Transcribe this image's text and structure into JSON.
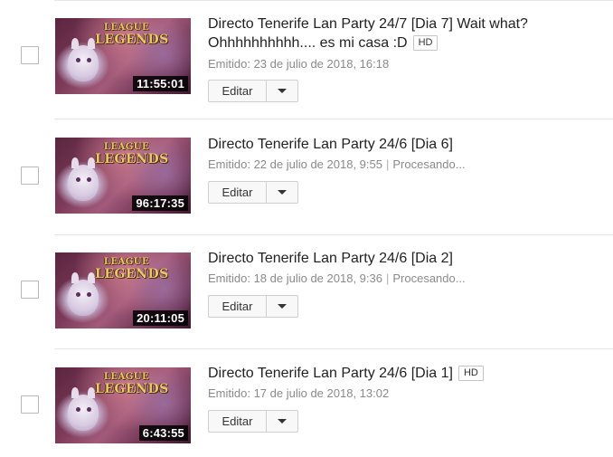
{
  "videos": [
    {
      "title": "Directo Tenerife Lan Party 24/7 [Dia 7] Wait what? Ohhhhhhhhhh.... es mi casa :D",
      "hd": "HD",
      "meta": "Emitido: 23 de julio de 2018, 16:18",
      "status": "",
      "duration": "11:55:01",
      "edit_label": "Editar",
      "thumb_logo_line1": "LEAGUE",
      "thumb_logo_line2": "LEGENDS"
    },
    {
      "title": "Directo Tenerife Lan Party 24/6 [Dia 6]",
      "hd": "",
      "meta": "Emitido: 22 de julio de 2018, 9:55",
      "status": "Procesando...",
      "duration": "96:17:35",
      "edit_label": "Editar",
      "thumb_logo_line1": "LEAGUE",
      "thumb_logo_line2": "LEGENDS"
    },
    {
      "title": "Directo Tenerife Lan Party 24/6 [Dia 2]",
      "hd": "",
      "meta": "Emitido: 18 de julio de 2018, 9:36",
      "status": "Procesando...",
      "duration": "20:11:05",
      "edit_label": "Editar",
      "thumb_logo_line1": "LEAGUE",
      "thumb_logo_line2": "LEGENDS"
    },
    {
      "title": "Directo Tenerife Lan Party 24/6 [Dia 1]",
      "hd": "HD",
      "meta": "Emitido: 17 de julio de 2018, 13:02",
      "status": "",
      "duration": "6:43:55",
      "edit_label": "Editar",
      "thumb_logo_line1": "LEAGUE",
      "thumb_logo_line2": "LEGENDS"
    }
  ],
  "status_separator": "|",
  "icons": {
    "dropdown": "chevron-down-icon",
    "checkbox": "checkbox"
  }
}
